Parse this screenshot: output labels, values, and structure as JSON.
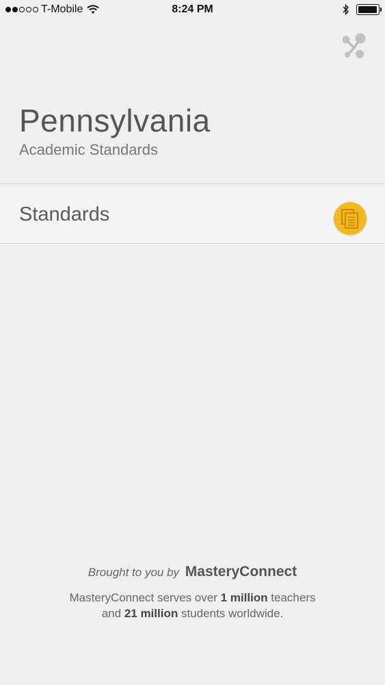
{
  "status_bar": {
    "carrier": "T-Mobile",
    "time": "8:24 PM",
    "signal_bars_filled": 2,
    "signal_bars_total": 5,
    "battery_level": 0.95
  },
  "header": {
    "title": "Pennsylvania",
    "subtitle": "Academic Standards",
    "share_icon": "share-icon"
  },
  "menu": {
    "standards_label": "Standards",
    "standards_icon": "documents-icon",
    "accent_color": "#f2b821"
  },
  "footer": {
    "brought_prefix": "Brought to you by",
    "brand": "MasteryConnect",
    "line1_prefix": "MasteryConnect serves over ",
    "line1_bold": "1 million",
    "line1_suffix": " teachers",
    "line2_prefix": "and ",
    "line2_bold": "21 million",
    "line2_suffix": " students worldwide."
  }
}
